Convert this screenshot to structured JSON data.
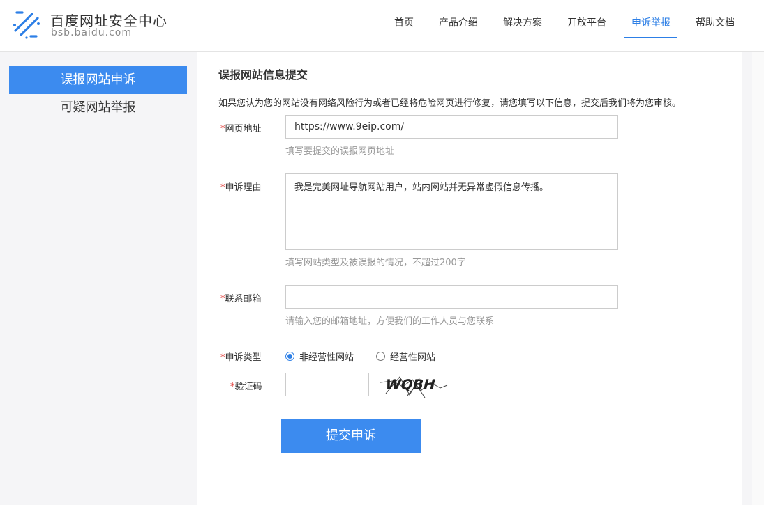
{
  "header": {
    "title": "百度网址安全中心",
    "subtitle": "bsb.baidu.com",
    "nav": [
      {
        "label": "首页"
      },
      {
        "label": "产品介绍"
      },
      {
        "label": "解决方案"
      },
      {
        "label": "开放平台"
      },
      {
        "label": "申诉举报",
        "active": true
      },
      {
        "label": "帮助文档"
      }
    ]
  },
  "sidebar": {
    "items": [
      {
        "label": "误报网站申诉",
        "active": true
      },
      {
        "label": "可疑网站举报"
      }
    ]
  },
  "form": {
    "title": "误报网站信息提交",
    "intro": "如果您认为您的网站没有网络风险行为或者已经将危险网页进行修复，请您填写以下信息，提交后我们将为您审核。",
    "required_mark": "*",
    "url": {
      "label": "网页地址",
      "value": "https://www.9eip.com/",
      "hint": "填写要提交的误报网页地址"
    },
    "reason": {
      "label": "申诉理由",
      "value": "我是完美网址导航网站用户，站内网站并无异常虚假信息传播。",
      "hint": "填写网站类型及被误报的情况，不超过200字"
    },
    "email": {
      "label": "联系邮箱",
      "value": "",
      "hint": "请输入您的邮箱地址，方便我们的工作人员与您联系"
    },
    "type": {
      "label": "申诉类型",
      "options": [
        {
          "label": "非经营性网站",
          "checked": true
        },
        {
          "label": "经营性网站",
          "checked": false
        }
      ]
    },
    "captcha": {
      "label": "验证码",
      "value": "",
      "image_text": "WQBH"
    },
    "submit_label": "提交申诉"
  },
  "colors": {
    "accent": "#3c8bef",
    "nav_active": "#2d7fe6",
    "required": "#e0332f",
    "hint": "#999999"
  }
}
